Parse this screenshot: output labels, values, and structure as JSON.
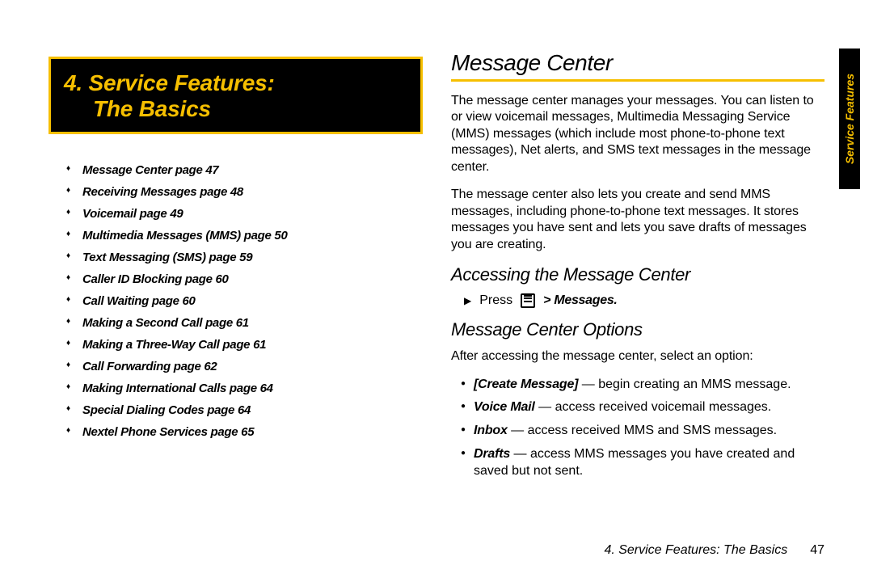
{
  "chapter": {
    "line1": "4.  Service Features:",
    "line2": "The Basics"
  },
  "toc": [
    "Message Center page 47",
    "Receiving Messages page 48",
    "Voicemail page 49",
    "Multimedia Messages (MMS) page 50",
    "Text Messaging (SMS) page 59",
    "Caller ID Blocking page 60",
    "Call Waiting page 60",
    "Making a Second Call page 61",
    "Making a Three-Way Call page 61",
    "Call Forwarding page 62",
    "Making International Calls page 64",
    "Special Dialing Codes page 64",
    "Nextel Phone Services page 65"
  ],
  "right": {
    "h1": "Message Center",
    "para1": "The message center manages your messages. You can listen to or view voicemail messages, Multimedia Messaging Service (MMS) messages (which include most phone-to-phone text messages), Net alerts, and SMS text messages in the message center.",
    "para2": "The message center also lets you create and send MMS messages, including phone-to-phone text messages. It stores messages you have sent and lets you save drafts of messages you are creating.",
    "h2a": "Accessing the Message Center",
    "step_press": "Press",
    "step_after": "> Messages.",
    "h2b": "Message Center Options",
    "afterAccess": "After accessing the message center, select an option:",
    "opts": [
      {
        "term": "[Create Message]",
        "desc": " — begin creating an MMS message."
      },
      {
        "term": "Voice Mail",
        "desc": " — access received voicemail messages."
      },
      {
        "term": "Inbox",
        "desc": " — access received MMS and SMS messages."
      },
      {
        "term": "Drafts",
        "desc": " — access MMS messages you have created and saved but not sent."
      }
    ]
  },
  "side_tab": "Service Features",
  "footer": {
    "title": "4. Service Features: The Basics",
    "page": "47"
  }
}
